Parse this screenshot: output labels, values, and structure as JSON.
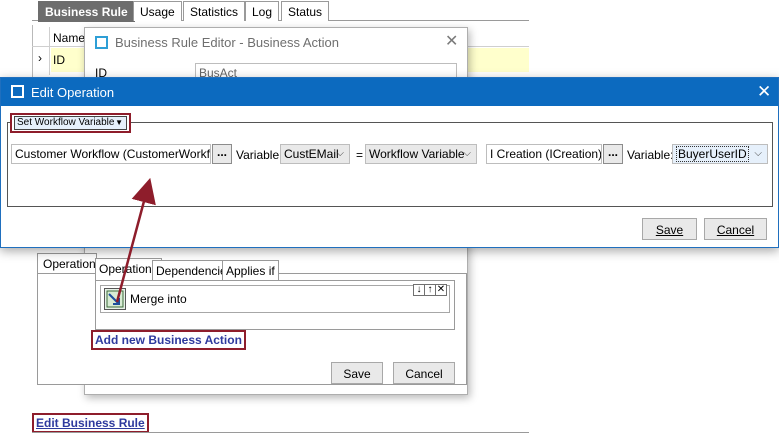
{
  "background_tabs": [
    "Business Rule",
    "Usage",
    "Statistics",
    "Log",
    "Status"
  ],
  "grid": {
    "header": "Name",
    "row_marker": "›",
    "row_value": "ID"
  },
  "bre": {
    "title": "Business Rule Editor - Business Action",
    "id_label": "ID",
    "id_value": "BusAct",
    "operations_panel_tab": "Operations",
    "inner_tabs": [
      "Operations",
      "Dependencies",
      "Applies if"
    ],
    "operation_row": "Merge  into",
    "mini_buttons": [
      "↓",
      "↑",
      "✕"
    ],
    "add_link": "Add new Business Action",
    "save": "Save",
    "cancel": "Cancel"
  },
  "edit_rule_link": "Edit Business Rule",
  "dialog": {
    "title": "Edit Operation",
    "operation_type": "Set Workflow Variable",
    "source_workflow": "Customer Workflow (CustomerWorkflow)",
    "variable_label": "Variable:",
    "source_variable": "CustEMail",
    "equals": "=",
    "value_type": "Workflow Variable",
    "target_workflow": "I Creation (ICreation)",
    "target_variable": "BuyerUserID",
    "browse": "...",
    "save": "Save",
    "cancel": "Cancel"
  },
  "colors": {
    "titlebar": "#0c6abf",
    "highlight_frame": "#8e1d2b",
    "link": "#2e3a9e",
    "grid_highlight": "#ffffcc"
  }
}
